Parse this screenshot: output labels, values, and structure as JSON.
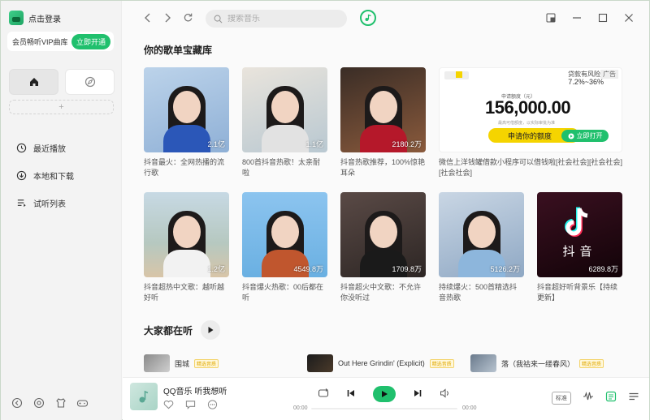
{
  "sidebar": {
    "login_text": "点击登录",
    "vip_text": "会员畅听VIP曲库",
    "vip_button": "立即开通",
    "add_label": "+",
    "menu": [
      {
        "label": "最近播放",
        "icon": "clock-icon"
      },
      {
        "label": "本地和下载",
        "icon": "download-icon"
      },
      {
        "label": "试听列表",
        "icon": "playlist-icon"
      }
    ]
  },
  "topbar": {
    "search_placeholder": "搜索音乐"
  },
  "main": {
    "section_title": "你的歌单宝藏库",
    "row1": [
      {
        "title": "抖音最火：全网热播的流行歌",
        "count": "2.1亿"
      },
      {
        "title": "800首抖音热歌！太亲耐啦",
        "count": "1.1亿"
      },
      {
        "title": "抖音热歌推荐，100%惊艳耳朵",
        "count": "2180.2万"
      }
    ],
    "ad": {
      "tag": "广告",
      "risk": "贷款有风险",
      "rate": "7.2%~36%",
      "sub": "申请额度（元）",
      "amount": "156,000.00",
      "note": "最高可借额度，以实际审批为准",
      "apply": "申请你的额度",
      "open": "立即打开",
      "title": "微信上洋钱罐借款小程序可以借钱啦[社会社会][社会社会][社会社会]"
    },
    "row2": [
      {
        "title": "抖音超热中文歌：越听越好听",
        "count": "1.2亿"
      },
      {
        "title": "抖音爆火热歌：00后都在听",
        "count": "4549.8万"
      },
      {
        "title": "抖音超火中文歌：不允许你没听过",
        "count": "1709.8万"
      },
      {
        "title": "持续爆火：500首精选抖音热歌",
        "count": "5126.2万"
      },
      {
        "title": "抖音超好听背景乐【持续更新】",
        "count": "6289.8万",
        "cover_text": "抖音"
      }
    ],
    "listen_title": "大家都在听",
    "songs": [
      {
        "name": "围城",
        "badge": "精选音质"
      },
      {
        "name": "Out Here Grindin' (Explicit)",
        "badge": "精选音质"
      },
      {
        "name": "落（我祜来一缕春风）",
        "badge": "精选音质"
      }
    ]
  },
  "player": {
    "title": "QQ音乐 听我想听",
    "time_start": "00:00",
    "time_end": "00:00",
    "quality": "标准"
  },
  "colors": {
    "accent": "#20c06d",
    "ad_yellow": "#f5d400"
  }
}
